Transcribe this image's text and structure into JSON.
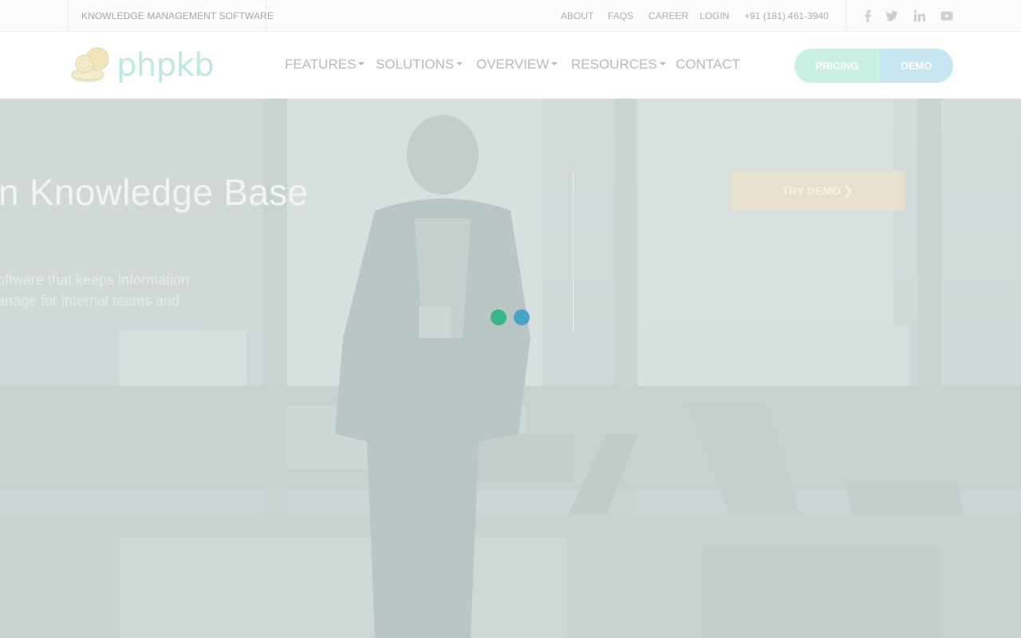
{
  "topbar": {
    "tagline": "KNOWLEDGE MANAGEMENT SOFTWARE",
    "links": [
      "ABOUT",
      "FAQS",
      "CAREER",
      "LOGIN"
    ],
    "phone": "+91 (181) 461-3940",
    "social": [
      "facebook-icon",
      "twitter-icon",
      "linkedin-icon",
      "youtube-icon"
    ]
  },
  "header": {
    "logo_text": "phpkb",
    "nav": [
      "FEATURES",
      "SOLUTIONS",
      "OVERVIEW",
      "RESOURCES",
      "CONTACT"
    ],
    "pricing_label": "PRICING",
    "demo_label": "DEMO"
  },
  "hero": {
    "title": "n Knowledge Base",
    "desc_line1": "oftware that keeps information",
    "desc_line2": "anage for internal teams and",
    "try_demo_label": "TRY DEMO ❯"
  },
  "colors": {
    "loader_green": "#3bb585",
    "loader_blue": "#4aa2c4",
    "pricing_bg": "#c9f0e1",
    "demo_bg": "#c8e6f2",
    "logo_teal": "#bfe8e1"
  }
}
